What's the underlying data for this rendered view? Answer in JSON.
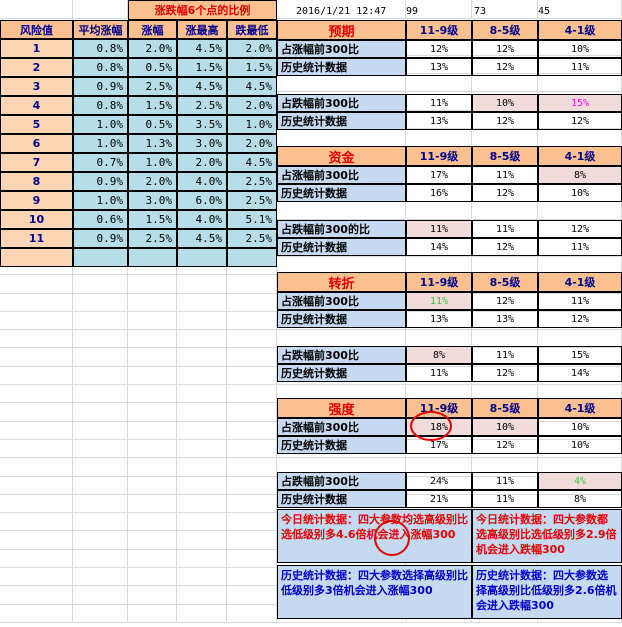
{
  "top": {
    "banner": "涨跌幅6个点的比例",
    "datetime": "2016/1/21  12:47",
    "v1": "99",
    "v2": "73",
    "v3": "45"
  },
  "risk_table": {
    "headers": [
      "风险值",
      "平均涨幅",
      "涨幅",
      "涨最高",
      "跌最低"
    ],
    "rows": [
      [
        "1",
        "0.8%",
        "2.0%",
        "4.5%",
        "2.0%"
      ],
      [
        "2",
        "0.8%",
        "0.5%",
        "1.5%",
        "1.5%"
      ],
      [
        "3",
        "0.9%",
        "2.5%",
        "4.5%",
        "4.5%"
      ],
      [
        "4",
        "0.8%",
        "1.5%",
        "2.5%",
        "2.0%"
      ],
      [
        "5",
        "1.0%",
        "0.5%",
        "3.5%",
        "1.0%"
      ],
      [
        "6",
        "1.0%",
        "1.3%",
        "3.0%",
        "2.0%"
      ],
      [
        "7",
        "0.7%",
        "1.0%",
        "2.0%",
        "4.5%"
      ],
      [
        "8",
        "0.9%",
        "2.0%",
        "4.0%",
        "2.5%"
      ],
      [
        "9",
        "1.0%",
        "3.0%",
        "6.0%",
        "2.5%"
      ],
      [
        "10",
        "0.6%",
        "1.5%",
        "4.0%",
        "5.1%"
      ],
      [
        "11",
        "0.9%",
        "2.5%",
        "4.5%",
        "2.5%"
      ]
    ]
  },
  "levels": [
    "11-9级",
    "8-5级",
    "4-1级"
  ],
  "sections": [
    {
      "title": "预期",
      "rows": [
        {
          "label": "占涨幅前300比",
          "vals": [
            "12%",
            "12%",
            "10%"
          ]
        },
        {
          "label": "历史统计数据",
          "vals": [
            "13%",
            "12%",
            "11%"
          ]
        },
        {
          "label": "",
          "vals": [
            "",
            "",
            ""
          ]
        },
        {
          "label": "占跌幅前300比",
          "vals": [
            "11%",
            "10%",
            "15%"
          ]
        },
        {
          "label": "历史统计数据",
          "vals": [
            "13%",
            "12%",
            "12%"
          ]
        }
      ]
    },
    {
      "title": "资金",
      "rows": [
        {
          "label": "占涨幅前300比",
          "vals": [
            "17%",
            "11%",
            "8%"
          ]
        },
        {
          "label": "历史统计数据",
          "vals": [
            "16%",
            "12%",
            "10%"
          ]
        },
        {
          "label": "",
          "vals": [
            "",
            "",
            ""
          ]
        },
        {
          "label": "占跌幅前300的比",
          "vals": [
            "11%",
            "11%",
            "12%"
          ]
        },
        {
          "label": "历史统计数据",
          "vals": [
            "14%",
            "12%",
            "11%"
          ]
        }
      ]
    },
    {
      "title": "转折",
      "rows": [
        {
          "label": "占涨幅前300比",
          "vals": [
            "11%",
            "12%",
            "11%"
          ]
        },
        {
          "label": "历史统计数据",
          "vals": [
            "13%",
            "13%",
            "12%"
          ]
        },
        {
          "label": "",
          "vals": [
            "",
            "",
            ""
          ]
        },
        {
          "label": "占跌幅前300比",
          "vals": [
            "8%",
            "11%",
            "15%"
          ]
        },
        {
          "label": "历史统计数据",
          "vals": [
            "11%",
            "12%",
            "14%"
          ]
        }
      ]
    },
    {
      "title": "强度",
      "rows": [
        {
          "label": "占涨幅前300比",
          "vals": [
            "18%",
            "10%",
            "10%"
          ]
        },
        {
          "label": "历史统计数据",
          "vals": [
            "17%",
            "12%",
            "10%"
          ]
        },
        {
          "label": "",
          "vals": [
            "",
            "",
            ""
          ]
        },
        {
          "label": "占跌幅前300比",
          "vals": [
            "24%",
            "11%",
            "4%"
          ]
        },
        {
          "label": "历史统计数据",
          "vals": [
            "21%",
            "11%",
            "8%"
          ]
        }
      ]
    }
  ],
  "notes": {
    "today_left": "今日统计数据：四大参数均选高级别比选低级别多4.6倍机会进入涨幅300",
    "today_right": "今日统计数据：四大参数都选高级别比选低级别多2.9倍机会进入跌幅300",
    "hist_left": "历史统计数据：四大参数选择高级别比低级别多3倍机会进入涨幅300",
    "hist_right": "历史统计数据：四大参数选择高级别比低级别多2.6倍机会进入跌幅300"
  },
  "colors": {
    "header_bg": "#fac090",
    "label_blue": "#c5d9f1",
    "value_blue": "#b7dee8",
    "highlight_pink": "#f2dcdb",
    "title_red": "#e60000",
    "text_blue": "#00008b"
  }
}
